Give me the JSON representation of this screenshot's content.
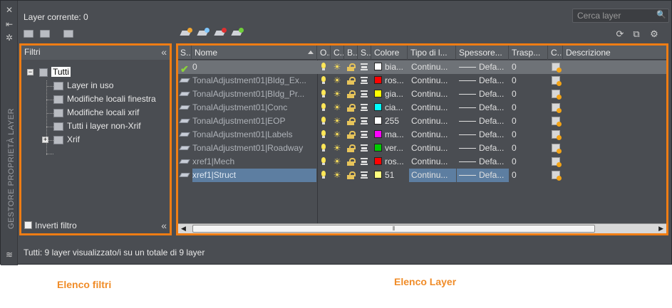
{
  "window": {
    "vertical_title": "GESTORE PROPRIETÀ LAYER",
    "current_layer": "Layer corrente: 0",
    "search_placeholder": "Cerca layer"
  },
  "filters_panel": {
    "header": "Filtri",
    "tree": [
      {
        "label": "Tutti",
        "selected": true
      },
      {
        "label": "Layer in uso"
      },
      {
        "label": "Modifiche locali finestra"
      },
      {
        "label": "Modifiche locali xrif"
      },
      {
        "label": "Tutti i layer non-Xrif"
      },
      {
        "label": "Xrif"
      }
    ],
    "invert_label": "Inverti filtro"
  },
  "layers_panel": {
    "columns": [
      "S..",
      "Nome",
      "O..",
      "C..",
      "B..",
      "S..",
      "Colore",
      "Tipo di l...",
      "Spessore...",
      "Trasp...",
      "C..",
      "Descrizione"
    ],
    "rows": [
      {
        "name": "0",
        "color_name": "bia...",
        "color": "#ffffff",
        "linetype": "Continu...",
        "lineweight": "Defa...",
        "transparency": "0",
        "current": true
      },
      {
        "name": "TonalAdjustment01|Bldg_Ex...",
        "color_name": "ros...",
        "color": "#ff0000",
        "linetype": "Continu...",
        "lineweight": "Defa...",
        "transparency": "0"
      },
      {
        "name": "TonalAdjustment01|Bldg_Pr...",
        "color_name": "gia...",
        "color": "#ffff00",
        "linetype": "Continu...",
        "lineweight": "Defa...",
        "transparency": "0"
      },
      {
        "name": "TonalAdjustment01|Conc",
        "color_name": "cia...",
        "color": "#00ffff",
        "linetype": "Continu...",
        "lineweight": "Defa...",
        "transparency": "0"
      },
      {
        "name": "TonalAdjustment01|EOP",
        "color_name": "255",
        "color": "#ffffff",
        "linetype": "Continu...",
        "lineweight": "Defa...",
        "transparency": "0"
      },
      {
        "name": "TonalAdjustment01|Labels",
        "color_name": "ma...",
        "color": "#ff00ff",
        "linetype": "Continu...",
        "lineweight": "Defa...",
        "transparency": "0"
      },
      {
        "name": "TonalAdjustment01|Roadway",
        "color_name": "ver...",
        "color": "#00cc00",
        "linetype": "Continu...",
        "lineweight": "Defa...",
        "transparency": "0"
      },
      {
        "name": "xref1|Mech",
        "color_name": "ros...",
        "color": "#ff0000",
        "linetype": "Continu...",
        "lineweight": "Defa...",
        "transparency": "0"
      },
      {
        "name": "xref1|Struct",
        "color_name": "51",
        "color": "#ffff80",
        "linetype": "Continu...",
        "lineweight": "Defa...",
        "transparency": "0",
        "selected": true
      }
    ]
  },
  "status": "Tutti: 9 layer visualizzato/i su un totale di 9 layer",
  "captions": {
    "filters": "Elenco filtri",
    "layers": "Elenco Layer"
  },
  "accent": "#ef7d14"
}
